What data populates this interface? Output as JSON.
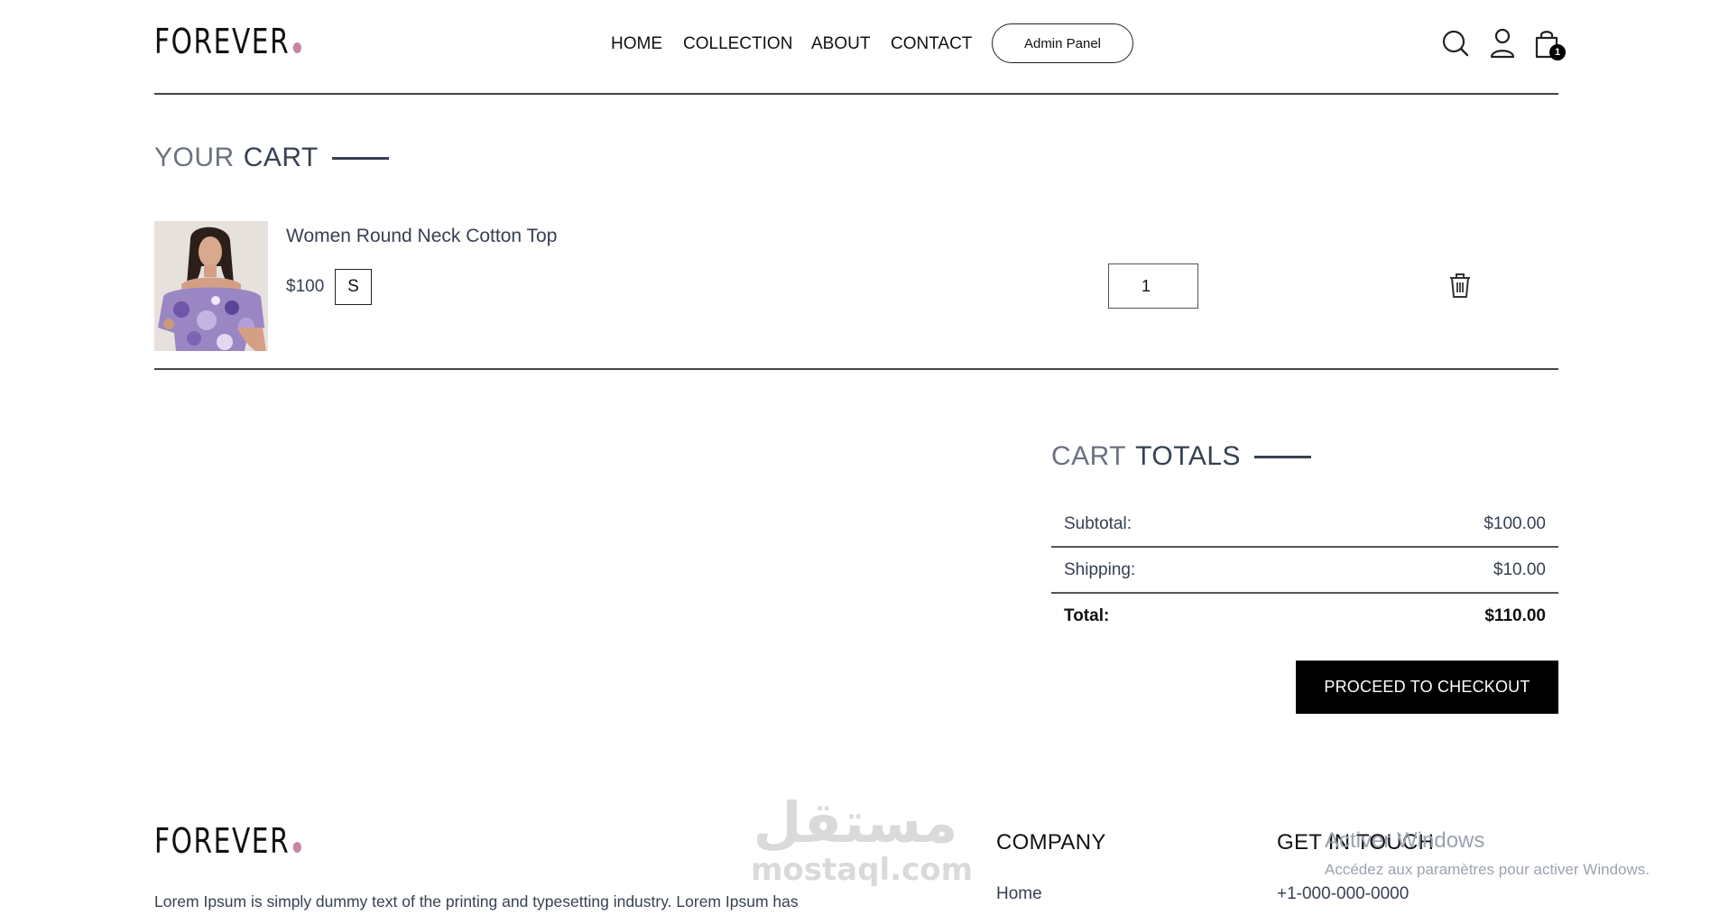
{
  "header": {
    "logo_text": "FOREVER",
    "nav": [
      {
        "label": "HOME"
      },
      {
        "label": "COLLECTION"
      },
      {
        "label": "ABOUT"
      },
      {
        "label": "CONTACT"
      }
    ],
    "admin_button": "Admin Panel",
    "icons": [
      "search-icon",
      "user-icon",
      "shopping-bag-icon"
    ],
    "cart_count": "1"
  },
  "cart": {
    "title_part1": "YOUR",
    "title_part2": "CART",
    "items": [
      {
        "name": "Women Round Neck Cotton Top",
        "price": "$100",
        "size": "S",
        "quantity": "1"
      }
    ]
  },
  "totals": {
    "title_part1": "CART",
    "title_part2": "TOTALS",
    "subtotal_label": "Subtotal:",
    "subtotal_value": "$100.00",
    "shipping_label": "Shipping:",
    "shipping_value": "$10.00",
    "total_label": "Total:",
    "total_value": "$110.00",
    "checkout_button": "PROCEED TO CHECKOUT"
  },
  "footer": {
    "logo_text": "FOREVER",
    "description": "Lorem Ipsum is simply dummy text of the printing and typesetting industry. Lorem Ipsum has",
    "company_heading": "COMPANY",
    "company_links": [
      "Home"
    ],
    "contact_heading": "GET IN TOUCH",
    "contact_phone": "+1-000-000-0000"
  },
  "overlays": {
    "watermark_arabic": "مستقل",
    "watermark_latin": "mostaql.com",
    "activate_title": "Activer Windows",
    "activate_sub": "Accédez aux paramètres pour activer Windows."
  },
  "colors": {
    "logo_dot": "#c586a5",
    "button_bg": "#000000",
    "title_muted": "#6b7280",
    "title_dark": "#374151"
  }
}
